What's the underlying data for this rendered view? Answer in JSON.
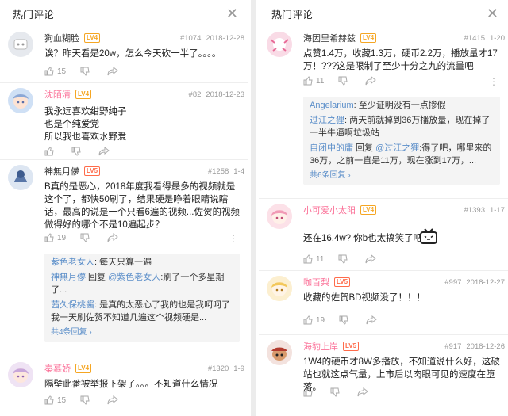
{
  "left": {
    "header": {
      "title": "热门评论"
    },
    "comments": [
      {
        "user": "狗血糊脸",
        "level": "LV4",
        "floor": "#1074",
        "date": "2018-12-28",
        "text": [
          "诶？昨天看是20w，怎么今天砍一半了。。。。"
        ],
        "likes": "15"
      },
      {
        "user": "沈陌清",
        "level": "LV4",
        "floor": "#82",
        "date": "2018-12-23",
        "text": [
          "我永远喜欢绀野纯子",
          "也是个纯爱党",
          "所以我也喜欢水野爱"
        ],
        "likes": ""
      },
      {
        "user": "神無月儚",
        "level": "LV5",
        "floor": "#1258",
        "date": "1-4",
        "text": [
          "B真的是恶心，2018年度我看得最多的视频就是这个了，都快50刷了，结果硬是睁着眼睛说瞎话，最高的说是一个只看6遍的视频...佐贺的视频做得好的哪个不是10遍起步？"
        ],
        "likes": "19",
        "replies": [
          {
            "name": "紫色老女人",
            "text": ": 每天只算一遍"
          },
          {
            "name": "神無月儚",
            "text": " 回复 ",
            "to": "@紫色老女人",
            "text2": ":刷了一个多星期了..."
          },
          {
            "name": "茜久保桃酱",
            "text": ": 是真的太恶心了我的也是我呵呵了我一天刷佐贺不知道几遍这个视频硬是..."
          }
        ],
        "more": "共4条回复"
      },
      {
        "user": "秦慕娇",
        "level": "LV4",
        "floor": "#1320",
        "date": "1-9",
        "text": [
          "隔壁此番被举报下架了。。。不知道什么情况"
        ],
        "likes": "15"
      }
    ]
  },
  "right": {
    "header": {
      "title": "热门评论"
    },
    "comments": [
      {
        "user": "海因里希赫兹",
        "level": "LV4",
        "floor": "#1415",
        "date": "1-20",
        "text": [
          "点赞1.4万，收藏1.3万，硬币2.2万，播放量才17万！???这是限制了至少十分之九的流量吧"
        ],
        "likes": "11",
        "replies": [
          {
            "name": "Angelarium",
            "text": ": 至少证明没有一点掺假"
          },
          {
            "name": "过江之狸",
            "text": ": 两天前就掉到36万播放量，现在掉了一半牛逼啊垃圾站"
          },
          {
            "name": "自闭中的庸",
            "text": " 回复 ",
            "to": "@过江之狸",
            "text2": ":得了吧，哪里来的36万，之前一直是11万，现在涨到17万，..."
          }
        ],
        "more": "共6条回复"
      },
      {
        "user": "小可爱小太阳",
        "level": "LV4",
        "floor": "#1393",
        "date": "1-17",
        "text": [
          "还在16.4w? 你b也太搞笑了吧"
        ],
        "likes": "11"
      },
      {
        "user": "咖百梨",
        "level": "LV5",
        "floor": "#997",
        "date": "2018-12-27",
        "text": [
          "收藏的佐贺BD视频没了！！！"
        ],
        "likes": "19"
      },
      {
        "user": "海豹上岸",
        "level": "LV5",
        "floor": "#917",
        "date": "2018-12-26",
        "text": [
          "1W4的硬币才8W多播放，不知道说什么好，这破站也就这点气量，上市后以肉眼可见的速度在堕落。"
        ],
        "likes": ""
      }
    ]
  },
  "colors": {
    "lv4": "#f5a623",
    "lv5": "#ff6b4a",
    "pink_name": "#fb7299",
    "link": "#5b8ec9"
  },
  "icons": [
    "close-icon",
    "like-icon",
    "dislike-icon",
    "share-icon",
    "more-icon",
    "chevron-right-icon",
    "tv-sticker-icon"
  ]
}
